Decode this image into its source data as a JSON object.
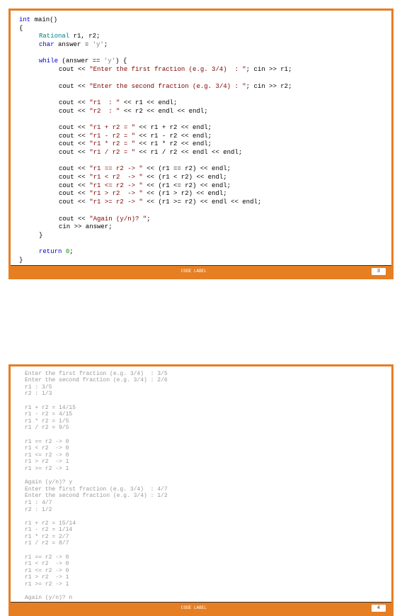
{
  "block1": {
    "lines": [
      {
        "cls": "",
        "html": [
          {
            "c": "kw-blue",
            "t": "int"
          },
          {
            "c": "",
            "t": " main()"
          }
        ]
      },
      {
        "cls": "",
        "html": [
          {
            "c": "",
            "t": "{"
          }
        ]
      },
      {
        "cls": "indent1",
        "html": [
          {
            "c": "kw-teal",
            "t": "Rational"
          },
          {
            "c": "",
            "t": " r1, r2;"
          }
        ]
      },
      {
        "cls": "indent1",
        "html": [
          {
            "c": "kw-blue",
            "t": "char"
          },
          {
            "c": "",
            "t": " answer = "
          },
          {
            "c": "kw-gray",
            "t": "'y'"
          },
          {
            "c": "",
            "t": ";"
          }
        ]
      },
      {
        "cls": "",
        "html": [
          {
            "c": "",
            "t": ""
          }
        ]
      },
      {
        "cls": "indent1",
        "html": [
          {
            "c": "kw-blue",
            "t": "while"
          },
          {
            "c": "",
            "t": " (answer == "
          },
          {
            "c": "kw-gray",
            "t": "'y'"
          },
          {
            "c": "",
            "t": ") {"
          }
        ]
      },
      {
        "cls": "indent2",
        "html": [
          {
            "c": "",
            "t": "cout << "
          },
          {
            "c": "kw-maroon",
            "t": "\"Enter the first fraction (e.g. 3/4)  : \""
          },
          {
            "c": "",
            "t": "; cin >> r1;"
          }
        ]
      },
      {
        "cls": "",
        "html": [
          {
            "c": "",
            "t": ""
          }
        ]
      },
      {
        "cls": "indent2",
        "html": [
          {
            "c": "",
            "t": "cout << "
          },
          {
            "c": "kw-maroon",
            "t": "\"Enter the second fraction (e.g. 3/4) : \""
          },
          {
            "c": "",
            "t": "; cin >> r2;"
          }
        ]
      },
      {
        "cls": "",
        "html": [
          {
            "c": "",
            "t": ""
          }
        ]
      },
      {
        "cls": "indent2",
        "html": [
          {
            "c": "",
            "t": "cout << "
          },
          {
            "c": "kw-maroon",
            "t": "\"r1  : \""
          },
          {
            "c": "",
            "t": " << r1 << endl;"
          }
        ]
      },
      {
        "cls": "indent2",
        "html": [
          {
            "c": "",
            "t": "cout << "
          },
          {
            "c": "kw-maroon",
            "t": "\"r2  : \""
          },
          {
            "c": "",
            "t": " << r2 << endl << endl;"
          }
        ]
      },
      {
        "cls": "",
        "html": [
          {
            "c": "",
            "t": ""
          }
        ]
      },
      {
        "cls": "indent2",
        "html": [
          {
            "c": "",
            "t": "cout << "
          },
          {
            "c": "kw-maroon",
            "t": "\"r1 + r2 = \""
          },
          {
            "c": "",
            "t": " << r1 + r2 << endl;"
          }
        ]
      },
      {
        "cls": "indent2",
        "html": [
          {
            "c": "",
            "t": "cout << "
          },
          {
            "c": "kw-maroon",
            "t": "\"r1 - r2 = \""
          },
          {
            "c": "",
            "t": " << r1 - r2 << endl;"
          }
        ]
      },
      {
        "cls": "indent2",
        "html": [
          {
            "c": "",
            "t": "cout << "
          },
          {
            "c": "kw-maroon",
            "t": "\"r1 * r2 = \""
          },
          {
            "c": "",
            "t": " << r1 * r2 << endl;"
          }
        ]
      },
      {
        "cls": "indent2",
        "html": [
          {
            "c": "",
            "t": "cout << "
          },
          {
            "c": "kw-maroon",
            "t": "\"r1 / r2 = \""
          },
          {
            "c": "",
            "t": " << r1 / r2 << endl << endl;"
          }
        ]
      },
      {
        "cls": "",
        "html": [
          {
            "c": "",
            "t": ""
          }
        ]
      },
      {
        "cls": "indent2",
        "html": [
          {
            "c": "",
            "t": "cout << "
          },
          {
            "c": "kw-maroon",
            "t": "\"r1 == r2 -> \""
          },
          {
            "c": "",
            "t": " << (r1 == r2) << endl;"
          }
        ]
      },
      {
        "cls": "indent2",
        "html": [
          {
            "c": "",
            "t": "cout << "
          },
          {
            "c": "kw-maroon",
            "t": "\"r1 < r2  -> \""
          },
          {
            "c": "",
            "t": " << (r1 < r2) << endl;"
          }
        ]
      },
      {
        "cls": "indent2",
        "html": [
          {
            "c": "",
            "t": "cout << "
          },
          {
            "c": "kw-maroon",
            "t": "\"r1 <= r2 -> \""
          },
          {
            "c": "",
            "t": " << (r1 <= r2) << endl;"
          }
        ]
      },
      {
        "cls": "indent2",
        "html": [
          {
            "c": "",
            "t": "cout << "
          },
          {
            "c": "kw-maroon",
            "t": "\"r1 > r2  -> \""
          },
          {
            "c": "",
            "t": " << (r1 > r2) << endl;"
          }
        ]
      },
      {
        "cls": "indent2",
        "html": [
          {
            "c": "",
            "t": "cout << "
          },
          {
            "c": "kw-maroon",
            "t": "\"r1 >= r2 -> \""
          },
          {
            "c": "",
            "t": " << (r1 >= r2) << endl << endl;"
          }
        ]
      },
      {
        "cls": "",
        "html": [
          {
            "c": "",
            "t": ""
          }
        ]
      },
      {
        "cls": "indent2",
        "html": [
          {
            "c": "",
            "t": "cout << "
          },
          {
            "c": "kw-maroon",
            "t": "\"Again (y/n)? \""
          },
          {
            "c": "",
            "t": ";"
          }
        ]
      },
      {
        "cls": "indent2",
        "html": [
          {
            "c": "",
            "t": "cin >> answer;"
          }
        ]
      },
      {
        "cls": "indent1",
        "html": [
          {
            "c": "",
            "t": "}"
          }
        ]
      },
      {
        "cls": "",
        "html": [
          {
            "c": "",
            "t": ""
          }
        ]
      },
      {
        "cls": "indent1",
        "html": [
          {
            "c": "kw-blue",
            "t": "return"
          },
          {
            "c": "",
            "t": " "
          },
          {
            "c": "kw-green",
            "t": "0"
          },
          {
            "c": "",
            "t": ";"
          }
        ]
      },
      {
        "cls": "",
        "html": [
          {
            "c": "",
            "t": "}"
          }
        ]
      }
    ],
    "footer_center": "CODE LABEL",
    "footer_page": "3"
  },
  "block2": {
    "lines": [
      "Enter the first fraction (e.g. 3/4)  : 3/5",
      "Enter the second fraction (e.g. 3/4) : 2/6",
      "r1 : 3/5",
      "r2 : 1/3",
      "",
      "r1 + r2 = 14/15",
      "r1 - r2 = 4/15",
      "r1 * r2 = 1/5",
      "r1 / r2 = 9/5",
      "",
      "r1 == r2 -> 0",
      "r1 < r2  -> 0",
      "r1 <= r2 -> 0",
      "r1 > r2  -> 1",
      "r1 >= r2 -> 1",
      "",
      "Again (y/n)? y",
      "Enter the first fraction (e.g. 3/4)  : 4/7",
      "Enter the second fraction (e.g. 3/4) : 1/2",
      "r1 : 4/7",
      "r2 : 1/2",
      "",
      "r1 + r2 = 15/14",
      "r1 - r2 = 1/14",
      "r1 * r2 = 2/7",
      "r1 / r2 = 8/7",
      "",
      "r1 == r2 -> 0",
      "r1 < r2  -> 0",
      "r1 <= r2 -> 0",
      "r1 > r2  -> 1",
      "r1 >= r2 -> 1",
      "",
      "Again (y/n)? n"
    ],
    "footer_center": "CODE LABEL",
    "footer_page": "4"
  }
}
